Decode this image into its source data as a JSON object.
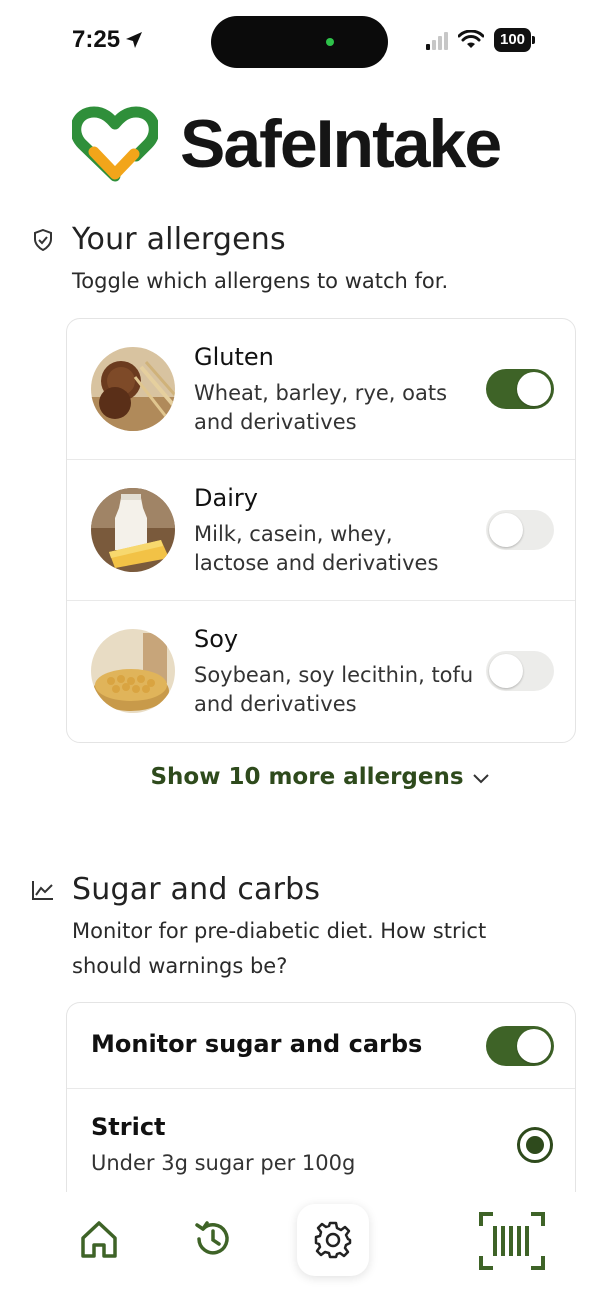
{
  "status_bar": {
    "time": "7:25",
    "battery": "100"
  },
  "app": {
    "name": "SafeIntake",
    "accent_color": "#3e6327",
    "logo_colors": [
      "#2f8f3a",
      "#f2a51a"
    ]
  },
  "allergens_section": {
    "title": "Your allergens",
    "description": "Toggle which allergens to watch for.",
    "items": [
      {
        "name": "Gluten",
        "description": "Wheat, barley, rye, oats and derivatives",
        "enabled": true
      },
      {
        "name": "Dairy",
        "description": "Milk, casein, whey, lactose and derivatives",
        "enabled": false
      },
      {
        "name": "Soy",
        "description": "Soybean, soy lecithin, tofu and derivatives",
        "enabled": false
      }
    ],
    "show_more_label": "Show 10 more allergens"
  },
  "sugar_section": {
    "title": "Sugar and carbs",
    "description": "Monitor for pre-diabetic diet. How strict should warnings be?",
    "monitor_label": "Monitor sugar and carbs",
    "monitor_enabled": true,
    "options": [
      {
        "label": "Strict",
        "description": "Under 3g sugar per 100g",
        "selected": true
      }
    ]
  },
  "bottom_nav": {
    "items": [
      {
        "icon": "home-icon"
      },
      {
        "icon": "history-icon"
      },
      {
        "icon": "gear-icon",
        "active": true
      },
      {
        "icon": "barcode-scan-icon"
      }
    ]
  }
}
